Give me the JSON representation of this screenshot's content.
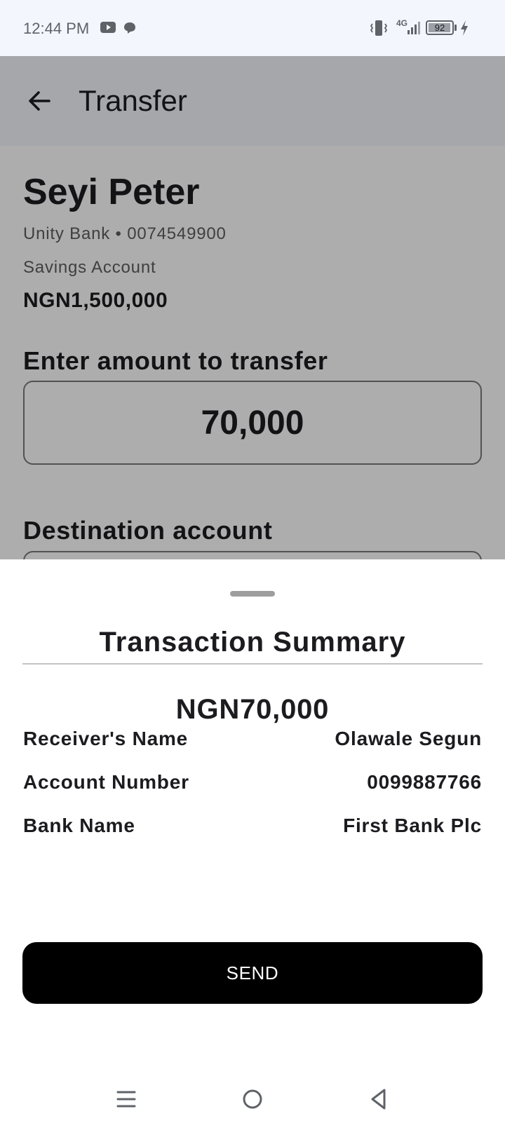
{
  "status_bar": {
    "time": "12:44 PM",
    "network": "4G",
    "battery": "92"
  },
  "app_bar": {
    "title": "Transfer"
  },
  "payer": {
    "name": "Seyi Peter",
    "bank_line": "Unity Bank • 0074549900",
    "account_type": "Savings Account",
    "balance": "NGN1,500,000"
  },
  "amount_section": {
    "heading": "Enter amount to transfer",
    "value": "70,000"
  },
  "destination_section": {
    "heading": "Destination account"
  },
  "summary": {
    "title": "Transaction Summary",
    "amount": "NGN70,000",
    "rows": [
      {
        "label": "Receiver's Name",
        "value": "Olawale Segun"
      },
      {
        "label": "Account Number",
        "value": "0099887766"
      },
      {
        "label": "Bank Name",
        "value": "First Bank Plc"
      }
    ],
    "send_label": "SEND"
  },
  "icons": {
    "status_left": [
      "youtube-icon",
      "chat-icon"
    ],
    "status_right": [
      "vibrate-icon",
      "signal-icon",
      "battery-icon",
      "charging-icon"
    ],
    "nav": [
      "recents-icon",
      "home-icon",
      "back-triangle-icon"
    ]
  }
}
